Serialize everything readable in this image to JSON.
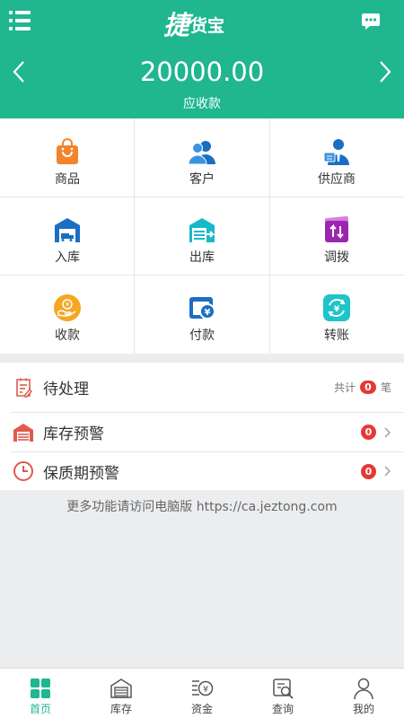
{
  "colors": {
    "brand": "#1fb690",
    "badge": "#e53935",
    "background": "#ecedef"
  },
  "header": {
    "logo_mark": "捷",
    "logo_text": "货宝",
    "amount": "20000.00",
    "amount_label": "应收款",
    "icons": {
      "menu": "menu-icon",
      "message": "message-icon",
      "prev": "chevron-left-icon",
      "next": "chevron-right-icon"
    }
  },
  "grid": [
    {
      "label": "商品",
      "icon": "bag-icon"
    },
    {
      "label": "客户",
      "icon": "customers-icon"
    },
    {
      "label": "供应商",
      "icon": "supplier-icon"
    },
    {
      "label": "入库",
      "icon": "warehouse-in-icon"
    },
    {
      "label": "出库",
      "icon": "warehouse-out-icon"
    },
    {
      "label": "调拨",
      "icon": "transfer-icon"
    },
    {
      "label": "收款",
      "icon": "receive-payment-icon"
    },
    {
      "label": "付款",
      "icon": "payment-icon"
    },
    {
      "label": "转账",
      "icon": "transfer-money-icon"
    }
  ],
  "list": {
    "pending": {
      "title": "待处理",
      "total_prefix": "共计",
      "count": "0",
      "total_suffix": "笔",
      "icon": "clipboard-icon"
    },
    "stock_alert": {
      "title": "库存预警",
      "count": "0",
      "icon": "warehouse-alert-icon"
    },
    "expiry_alert": {
      "title": "保质期预警",
      "count": "0",
      "icon": "clock-icon"
    }
  },
  "footer_note": "更多功能请访问电脑版 https://ca.jeztong.com",
  "tabs": [
    {
      "label": "首页",
      "icon": "home-grid-icon",
      "active": true
    },
    {
      "label": "库存",
      "icon": "inventory-icon",
      "active": false
    },
    {
      "label": "资金",
      "icon": "funds-icon",
      "active": false
    },
    {
      "label": "查询",
      "icon": "query-icon",
      "active": false
    },
    {
      "label": "我的",
      "icon": "profile-icon",
      "active": false
    }
  ]
}
